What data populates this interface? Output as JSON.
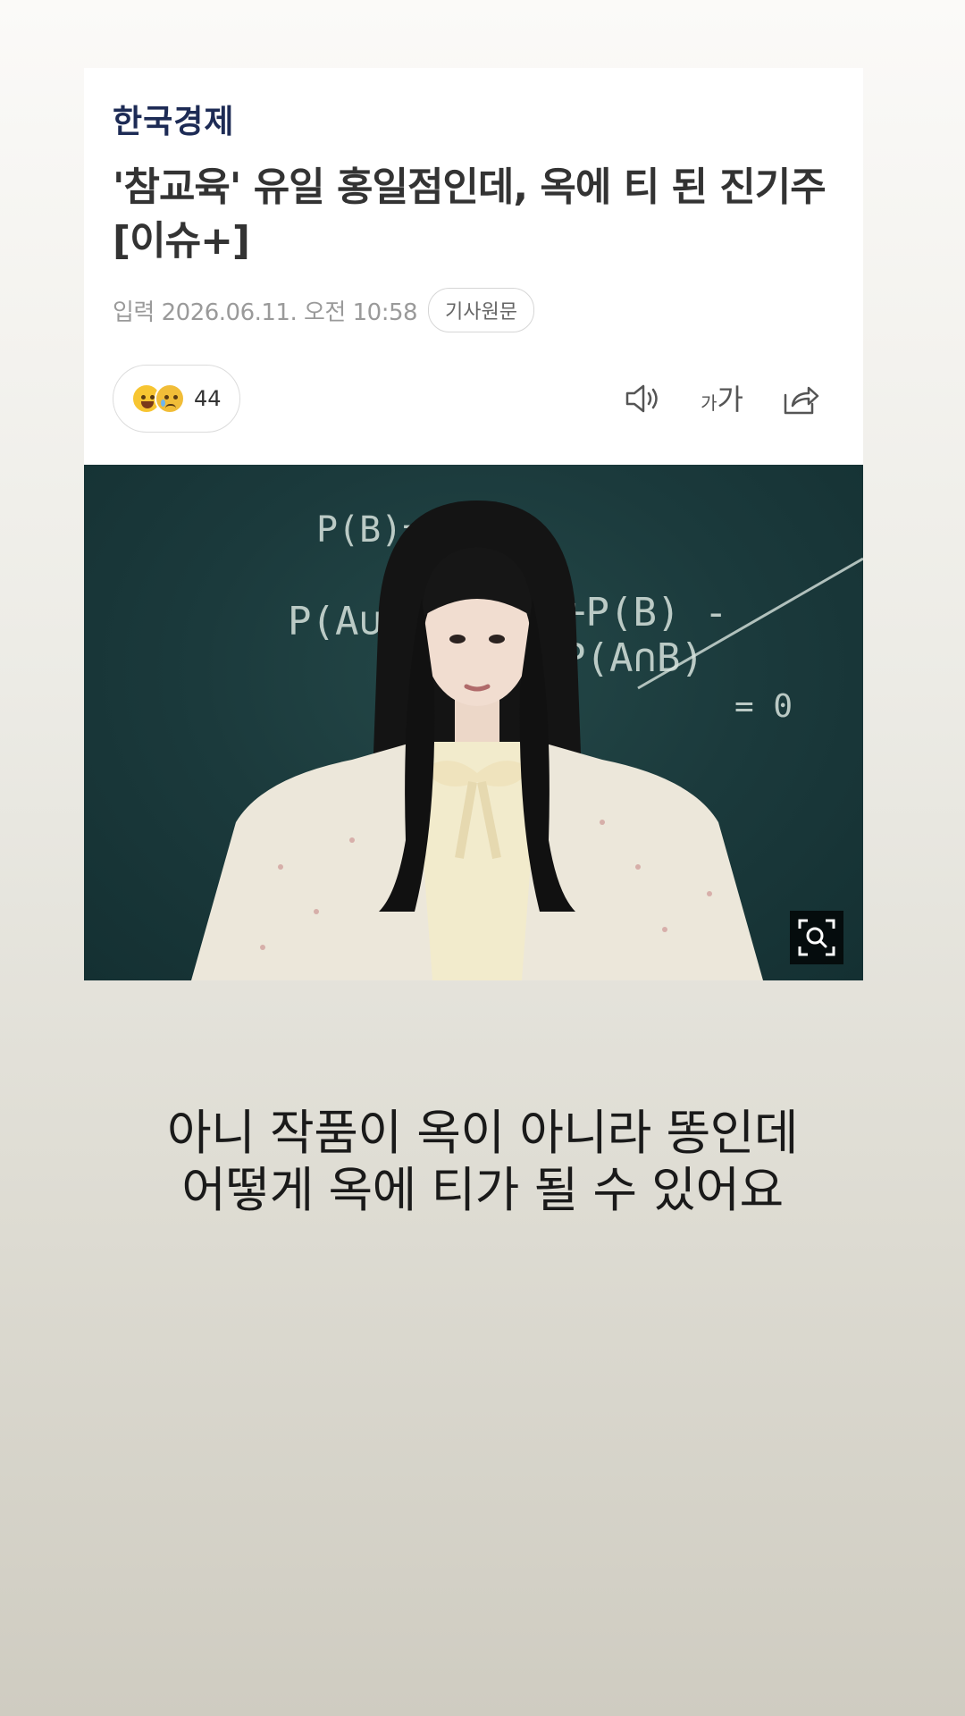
{
  "article": {
    "source": "한국경제",
    "headline": "'참교육' 유일 홍일점인데, 옥에 티 된 진기주 [이슈+]",
    "published": "입력 2026.06.11. 오전 10:58",
    "original_link_label": "기사원문",
    "reaction_count": "44",
    "font_size_small": "가",
    "font_size_large": "가"
  },
  "photo": {
    "chalk_lines": [
      "P(B)=?",
      "P(A∪",
      "+P(B) - P(A∩B)",
      "= 0"
    ]
  },
  "comment": {
    "line1": "아니 작품이 옥이 아니라 똥인데",
    "line2": "어떻게 옥에 티가 될 수 있어요"
  },
  "icons": {
    "reactions": [
      "smile-emoji-icon",
      "crying-emoji-icon"
    ],
    "tools": [
      "speaker-icon",
      "font-size-icon",
      "share-icon",
      "zoom-search-icon"
    ]
  },
  "colors": {
    "source_logo": "#1d2b55",
    "headline": "#333333",
    "meta": "#9a9a9a",
    "blackboard": "#1b3a3c"
  }
}
